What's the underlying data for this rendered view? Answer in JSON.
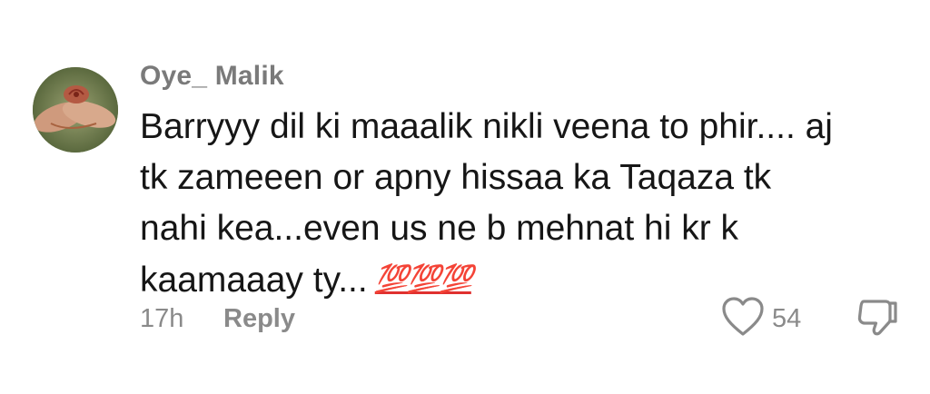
{
  "comment": {
    "username": "Oye_ Malik",
    "text_lines": [
      "Barryyy dil ki maaalik nikli veena to phir.... aj",
      "tk zameeen or apny hissaa ka Taqaza tk",
      "nahi kea...even us ne b mehnat hi kr k",
      "kaamaaay ty..."
    ],
    "emoji": "💯💯💯",
    "emoji_colors": {
      "hundred_red": "#e0312f"
    },
    "time": "17h",
    "reply_label": "Reply",
    "like_count": "54",
    "icons": {
      "like": "heart-outline-icon",
      "dislike": "thumbs-down-outline-icon"
    }
  },
  "colors": {
    "text_primary": "#161616",
    "text_secondary": "#8a8a8a",
    "username": "#7a7a7a",
    "background": "#ffffff"
  }
}
